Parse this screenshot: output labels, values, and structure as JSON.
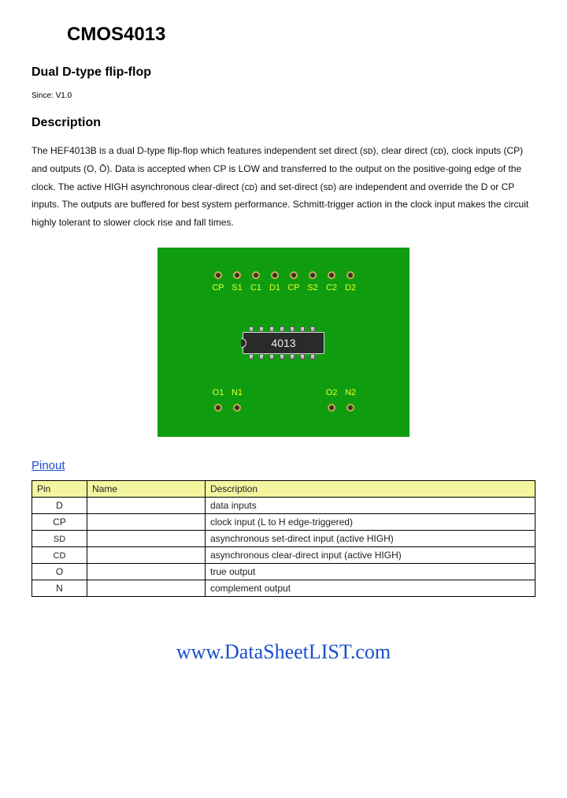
{
  "title": "CMOS4013",
  "subtitle": "Dual D-type flip-flop",
  "since": "Since: V1.0",
  "description_heading": "Description",
  "description": "The HEF4013B is a dual D-type flip-flop which features independent set direct (sᴅ), clear direct (cᴅ), clock inputs (CP) and outputs (O, Ō). Data is accepted when CP is LOW and transferred to the output on the positive-going edge of the clock. The active HIGH asynchronous clear-direct (cᴅ) and set-direct (sᴅ) are independent and override the D or CP inputs. The outputs are buffered for best system performance. Schmitt-trigger action in the clock input makes the circuit highly tolerant to slower clock rise and fall times.",
  "chip_label": "4013",
  "board_top_labels": [
    "CP",
    "S1",
    "C1",
    "D1",
    "CP",
    "S2",
    "C2",
    "D2"
  ],
  "board_bottom_labels": [
    "O1",
    "N1",
    "O2",
    "N2"
  ],
  "pinout_link": "Pinout",
  "table_headers": {
    "pin": "Pin",
    "name": "Name",
    "desc": "Description"
  },
  "pinout": [
    {
      "pin": "D",
      "name": "",
      "desc": "data inputs"
    },
    {
      "pin": "CP",
      "name": "",
      "desc": "clock input (L to H edge-triggered)"
    },
    {
      "pin": "SD",
      "name": "",
      "desc": "asynchronous set-direct input (active HIGH)"
    },
    {
      "pin": "CD",
      "name": "",
      "desc": "asynchronous clear-direct input (active HIGH)"
    },
    {
      "pin": "O",
      "name": "",
      "desc": "true output"
    },
    {
      "pin": "N",
      "name": "",
      "desc": "complement output"
    }
  ],
  "footer_url": "www.DataSheetLIST.com"
}
